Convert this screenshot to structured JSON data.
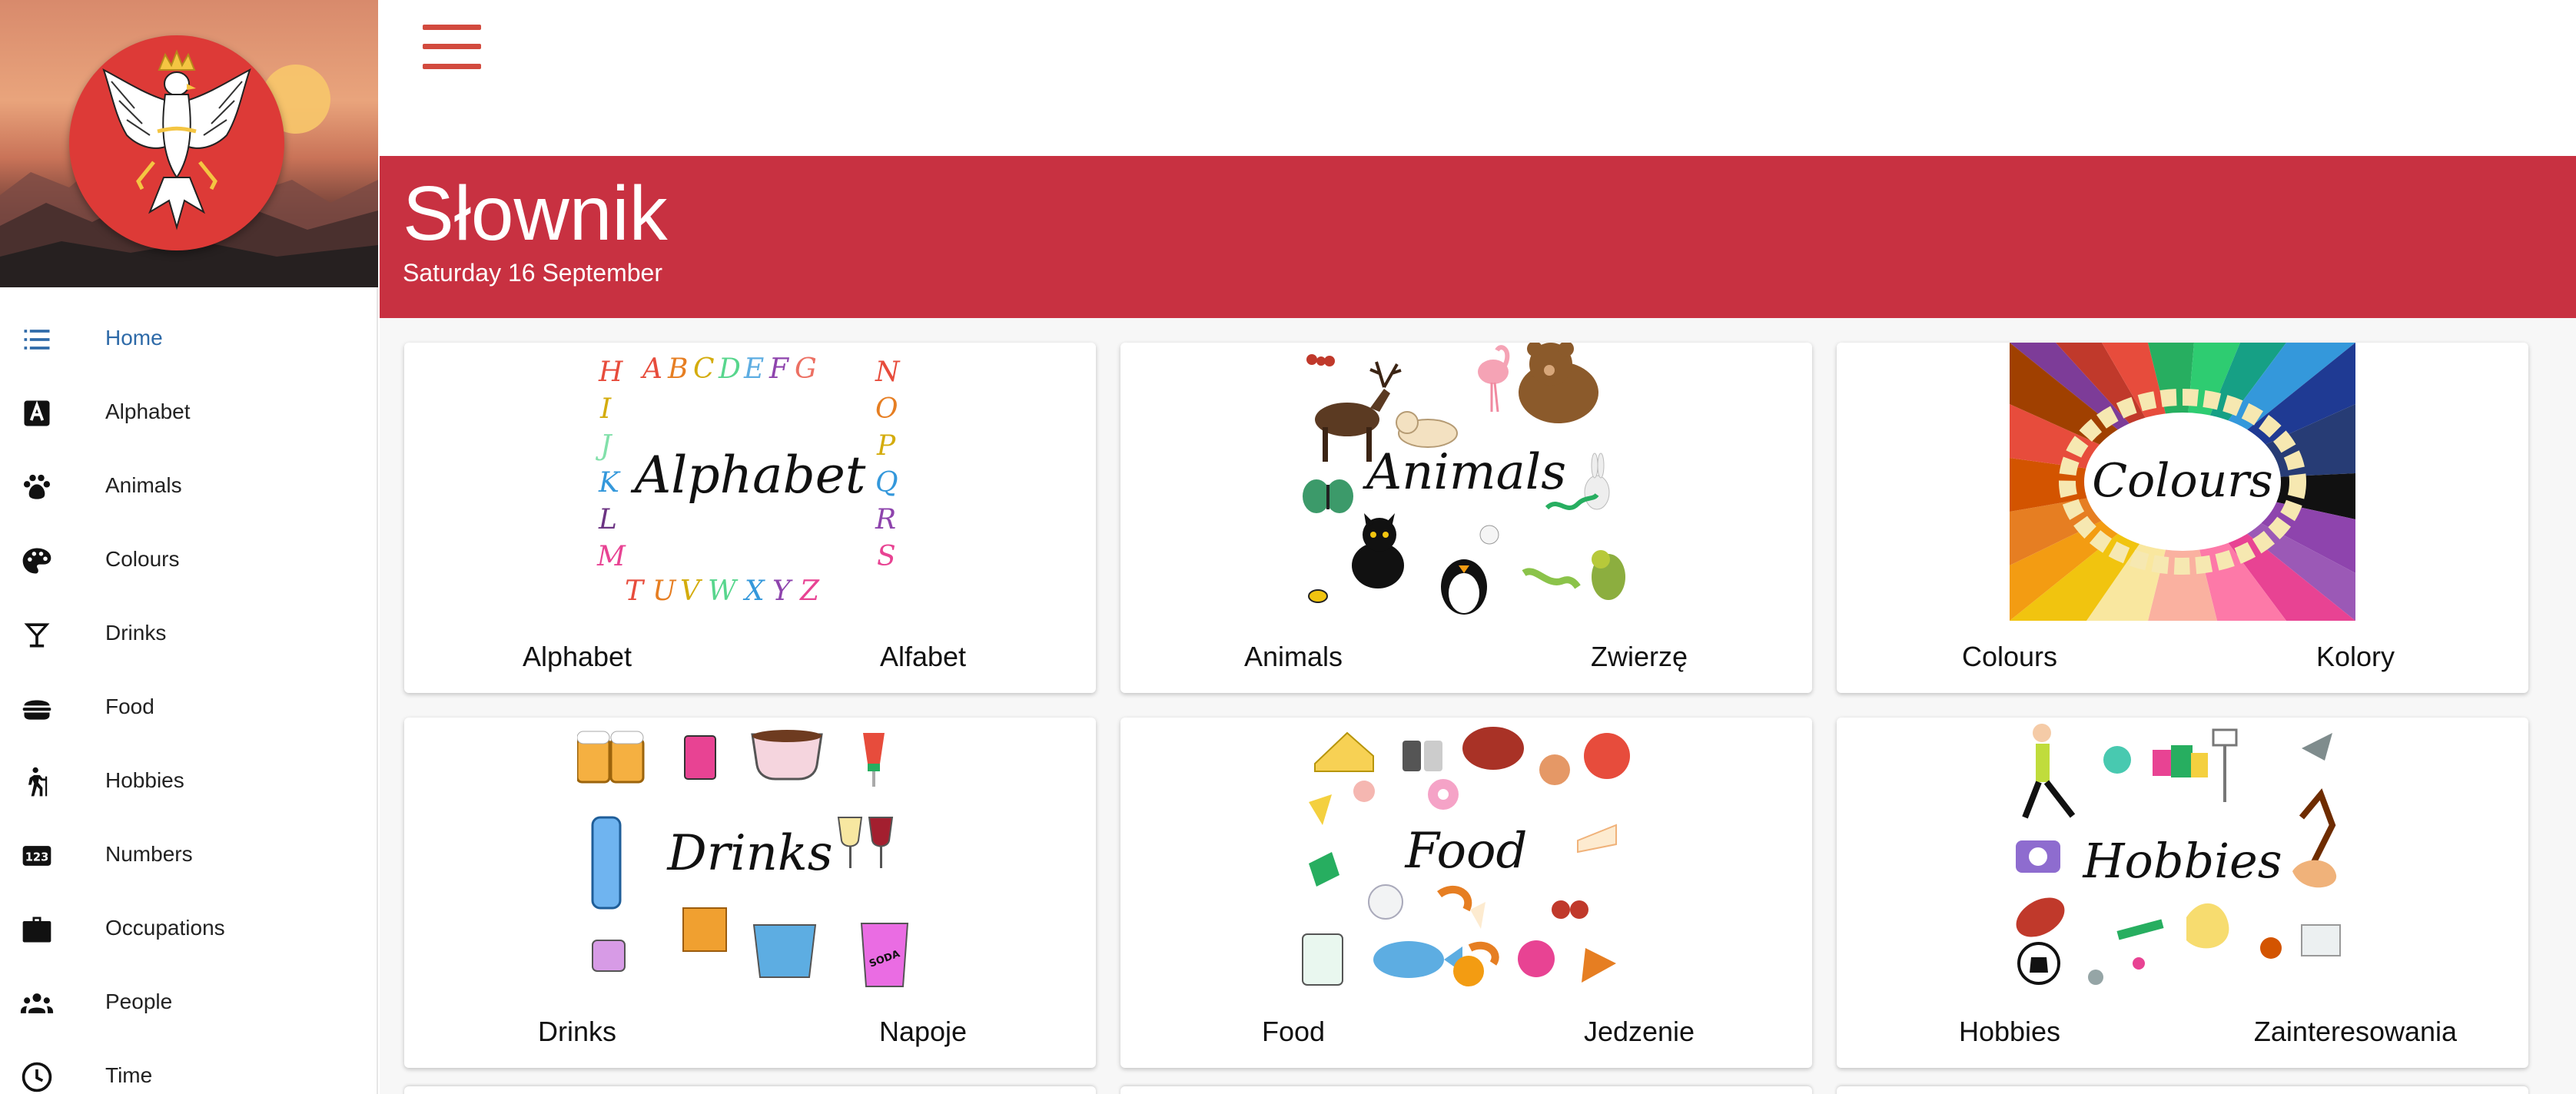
{
  "sidebar": {
    "items": [
      {
        "label": "Home",
        "icon": "list-icon",
        "active": true
      },
      {
        "label": "Alphabet",
        "icon": "letter-a-icon",
        "active": false
      },
      {
        "label": "Animals",
        "icon": "paw-icon",
        "active": false
      },
      {
        "label": "Colours",
        "icon": "palette-icon",
        "active": false
      },
      {
        "label": "Drinks",
        "icon": "cocktail-icon",
        "active": false
      },
      {
        "label": "Food",
        "icon": "burger-icon",
        "active": false
      },
      {
        "label": "Hobbies",
        "icon": "hiking-icon",
        "active": false
      },
      {
        "label": "Numbers",
        "icon": "numbers-123-icon",
        "active": false
      },
      {
        "label": "Occupations",
        "icon": "briefcase-icon",
        "active": false
      },
      {
        "label": "People",
        "icon": "people-icon",
        "active": false
      },
      {
        "label": "Time",
        "icon": "clock-icon",
        "active": false
      }
    ]
  },
  "header": {
    "title": "Słownik",
    "date": "Saturday 16 September"
  },
  "cards": [
    {
      "image_title": "Alphabet",
      "en": "Alphabet",
      "pl": "Alfabet"
    },
    {
      "image_title": "Animals",
      "en": "Animals",
      "pl": "Zwierzę"
    },
    {
      "image_title": "Colours",
      "en": "Colours",
      "pl": "Kolory"
    },
    {
      "image_title": "Drinks",
      "en": "Drinks",
      "pl": "Napoje"
    },
    {
      "image_title": "Food",
      "en": "Food",
      "pl": "Jedzenie"
    },
    {
      "image_title": "Hobbies",
      "en": "Hobbies",
      "pl": "Zainteresowania"
    }
  ],
  "alphabet_letters": {
    "top": [
      "A",
      "B",
      "C",
      "D",
      "E",
      "F",
      "G"
    ],
    "left": [
      "H",
      "I",
      "J",
      "K",
      "L",
      "M"
    ],
    "right": [
      "N",
      "O",
      "P",
      "Q",
      "R",
      "S"
    ],
    "bottom": [
      "T",
      "U",
      "V",
      "W",
      "X",
      "Y",
      "Z"
    ]
  },
  "drinks_cup_text": "SODA",
  "colors": {
    "accent": "#c83141",
    "menu": "#d24a3e",
    "active_nav": "#2e6aa8",
    "emblem_red": "#dd3a37"
  }
}
